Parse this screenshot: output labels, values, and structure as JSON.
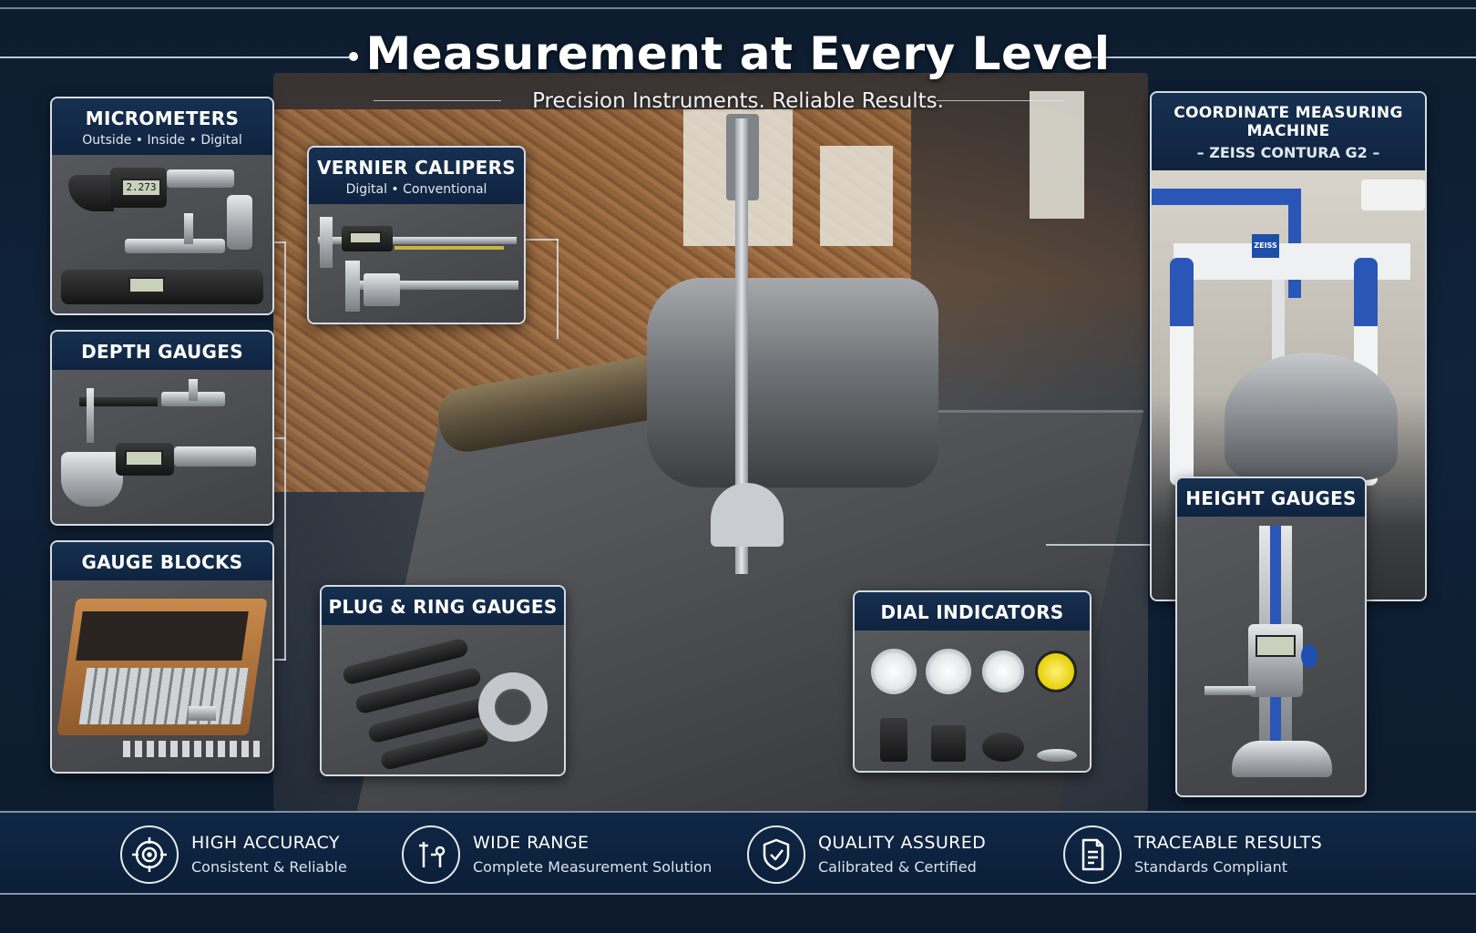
{
  "header": {
    "title": "Measurement at Every Level",
    "subtitle": "Precision Instruments. Reliable Results."
  },
  "panels": {
    "micrometers": {
      "title": "MICROMETERS",
      "subtitle": "Outside • Inside • Digital",
      "lcd": "2.273"
    },
    "vernier": {
      "title": "VERNIER CALIPERS",
      "subtitle": "Digital • Conventional"
    },
    "depth": {
      "title": "DEPTH GAUGES"
    },
    "gauge_blocks": {
      "title": "GAUGE BLOCKS"
    },
    "plug_ring": {
      "title": "PLUG & RING GAUGES"
    },
    "dial": {
      "title": "DIAL INDICATORS"
    },
    "cmm": {
      "title": "COORDINATE MEASURING MACHINE",
      "subtitle": "– ZEISS CONTURA G2 –",
      "brand": "ZEISS"
    },
    "height": {
      "title": "HEIGHT GAUGES"
    }
  },
  "features": [
    {
      "title": "HIGH ACCURACY",
      "subtitle": "Consistent & Reliable",
      "icon": "target-icon"
    },
    {
      "title": "WIDE RANGE",
      "subtitle": "Complete Measurement Solution",
      "icon": "caliper-icon"
    },
    {
      "title": "QUALITY ASSURED",
      "subtitle": "Calibrated & Certified",
      "icon": "shield-check-icon"
    },
    {
      "title": "TRACEABLE RESULTS",
      "subtitle": "Standards Compliant",
      "icon": "document-icon"
    }
  ],
  "colors": {
    "background": "#0d1c2e",
    "panel_header": "#12294a",
    "accent_blue": "#2a56b8",
    "dial_yellow": "#e7d20e"
  }
}
